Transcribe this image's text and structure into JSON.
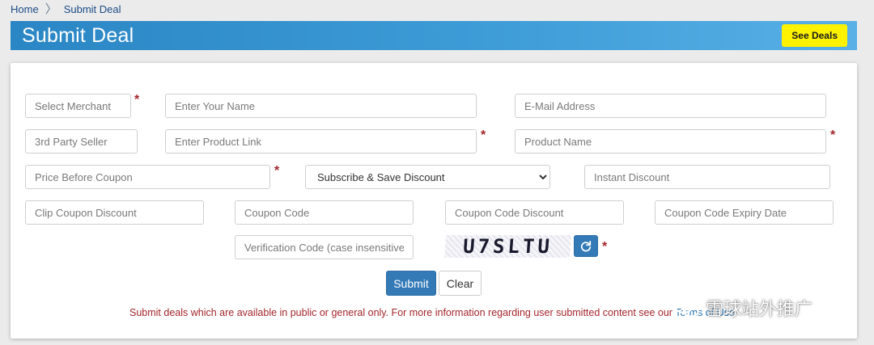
{
  "breadcrumb": {
    "home": "Home",
    "separator": "〉",
    "current": "Submit Deal"
  },
  "header": {
    "title": "Submit Deal",
    "see_deals_label": "See Deals"
  },
  "form": {
    "select_merchant": "Select Merchant",
    "name_placeholder": "Enter Your Name",
    "email_placeholder": "E-Mail Address",
    "third_party_placeholder": "3rd Party Seller",
    "product_link_placeholder": "Enter Product Link",
    "product_name_placeholder": "Product Name",
    "price_placeholder": "Price Before Coupon",
    "discount_type_selected": "Subscribe & Save Discount",
    "instant_discount_placeholder": "Instant Discount",
    "clip_coupon_placeholder": "Clip Coupon Discount",
    "coupon_code_placeholder": "Coupon Code",
    "coupon_discount_placeholder": "Coupon Code Discount",
    "coupon_expiry_placeholder": "Coupon Code Expiry Date",
    "verification_placeholder": "Verification Code (case insensitive).",
    "captcha_text": "U7SLTU",
    "required_marker": "*",
    "submit_label": "Submit",
    "clear_label": "Clear"
  },
  "notice": {
    "text": "Submit deals which are available in public or general only. For more information regarding user submitted content see our ",
    "link_text": "Terms of Use"
  },
  "watermark": {
    "text": "雪球站外推广",
    "icon": "wechat-icon"
  },
  "colors": {
    "header_blue": "#2a86c4",
    "accent_yellow": "#fef200",
    "button_blue": "#337ab7",
    "required_red": "#a4262c",
    "link_blue": "#1f70b3"
  }
}
